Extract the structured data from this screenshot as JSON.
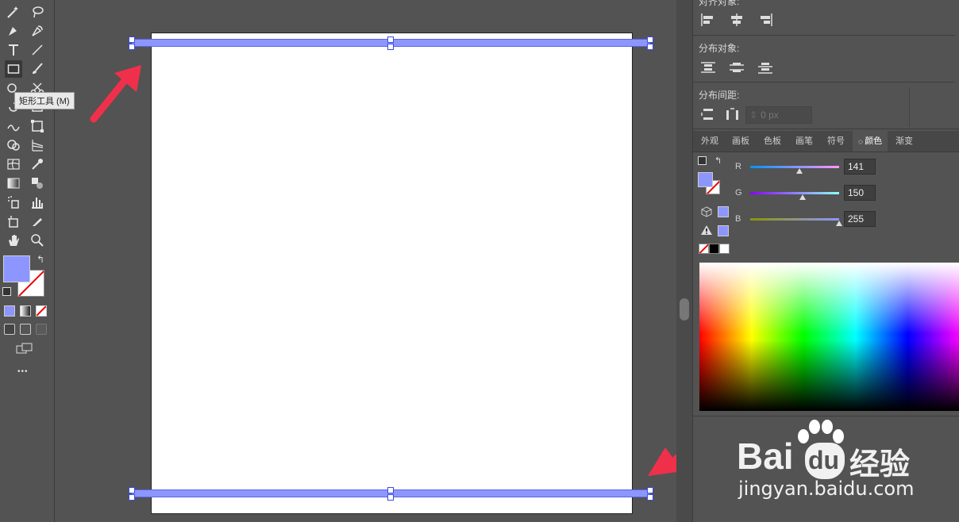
{
  "toolbar": {
    "tooltip": "矩形工具 (M)",
    "more_label": "•••",
    "fill_color": "#8d96ff",
    "icons": [
      "magic-wand",
      "lasso",
      "pen",
      "curvature",
      "type",
      "line",
      "rectangle",
      "paintbrush",
      "shaper",
      "scissors",
      "rotate",
      "reflect",
      "width",
      "free-transform",
      "shape-builder",
      "perspective",
      "mesh",
      "eyedropper",
      "gradient",
      "blend",
      "symbol-sprayer",
      "column-graph",
      "artboard",
      "slice",
      "hand",
      "zoom"
    ]
  },
  "panel": {
    "align_objects_label": "对齐对象:",
    "distribute_objects_label": "分布对象:",
    "distribute_spacing_label": "分布间距:",
    "spacing_value": "0 px",
    "tabs": [
      "外观",
      "画板",
      "色板",
      "画笔",
      "符号",
      "颜色",
      "渐变"
    ],
    "active_tab": "颜色",
    "color": {
      "r_label": "R",
      "g_label": "G",
      "b_label": "B",
      "r": "141",
      "g": "150",
      "b": "255",
      "r_fraction": 0.553,
      "g_fraction": 0.588,
      "b_fraction": 1.0
    }
  },
  "watermark": {
    "brand": "Bai",
    "brand_du": "du",
    "brand_cn": "经验",
    "url": "jingyan.baidu.com"
  },
  "colors": {
    "accent": "#8d96ff",
    "arrow": "#f0304a"
  }
}
